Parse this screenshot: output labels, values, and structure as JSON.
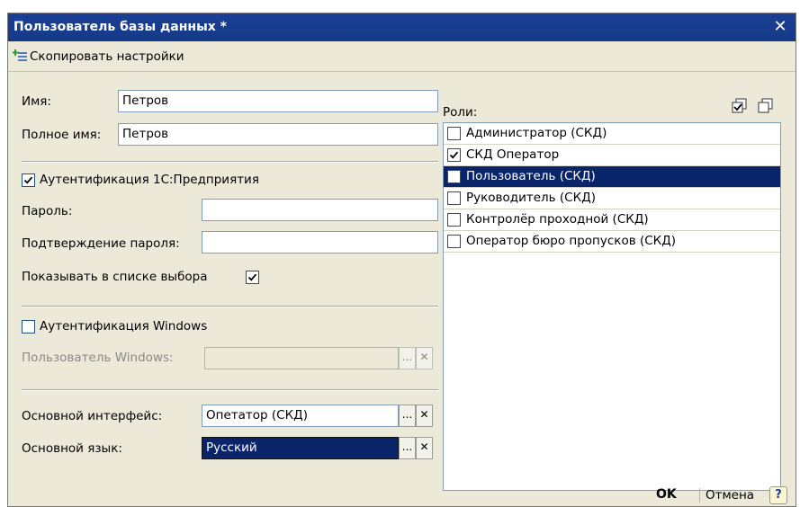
{
  "window": {
    "title": "Пользователь базы данных *",
    "close_glyph": "✕"
  },
  "toolbar": {
    "copy_label": "Скопировать настройки",
    "copy_icon": "copy-settings-icon"
  },
  "form": {
    "name_label": "Имя:",
    "name_value": "Петров",
    "fullname_label": "Полное имя:",
    "fullname_value": "Петров",
    "auth_1c_label": "Аутентификация 1С:Предприятия",
    "auth_1c_checked": true,
    "password_label": "Пароль:",
    "password_value": "",
    "confirm_label": "Подтверждение пароля:",
    "confirm_value": "",
    "show_in_list_label": "Показывать в списке выбора",
    "show_in_list_checked": true,
    "auth_windows_label": "Аутентификация Windows",
    "auth_windows_checked": false,
    "windows_user_label": "Пользователь Windows:",
    "windows_user_value": "",
    "interface_label": "Основной интерфейс:",
    "interface_value": "Опетатор (СКД)",
    "language_label": "Основной язык:",
    "language_value": "Русский",
    "select_glyph": "...",
    "clear_glyph": "✕"
  },
  "roles": {
    "label": "Роли:",
    "items": [
      {
        "label": "Администратор (СКД)",
        "checked": false
      },
      {
        "label": "СКД Оператор",
        "checked": true
      },
      {
        "label": "Пользователь (СКД)",
        "checked": false,
        "selected": true
      },
      {
        "label": "Руководитель (СКД)",
        "checked": false
      },
      {
        "label": "Контролёр проходной (СКД)",
        "checked": false
      },
      {
        "label": "Оператор бюро пропусков (СКД)",
        "checked": false
      }
    ]
  },
  "footer": {
    "ok_label": "OK",
    "cancel_label": "Отмена",
    "help_label": "?"
  },
  "colors": {
    "titlebar": "#153a86",
    "selection": "#0a246a",
    "dialog_bg": "#ece9d8"
  }
}
